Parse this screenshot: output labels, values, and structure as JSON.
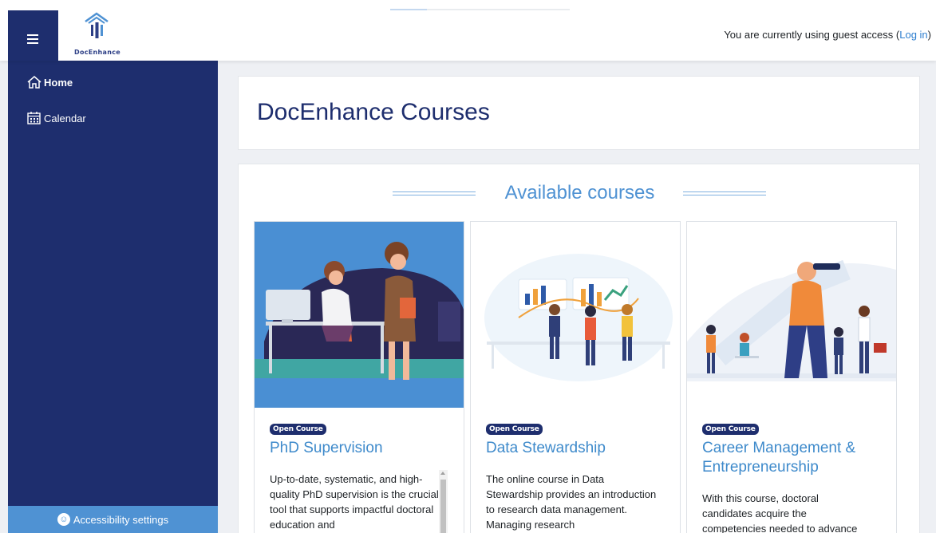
{
  "header": {
    "brand": "DocEnhance",
    "guest_text": "You are currently using guest access (",
    "login_link": "Log in",
    "guest_close": ")"
  },
  "sidebar": {
    "items": [
      {
        "label": "Home",
        "icon": "home-icon"
      },
      {
        "label": "Calendar",
        "icon": "calendar-icon"
      }
    ],
    "accessibility": "Accessibility settings"
  },
  "page": {
    "title": "DocEnhance Courses",
    "section_title": "Available courses"
  },
  "courses": [
    {
      "badge": "Open Course",
      "title": "PhD Supervision",
      "description": "Up-to-date, systematic, and high-quality PhD supervision is the crucial tool that supports impactful doctoral education and"
    },
    {
      "badge": "Open Course",
      "title": "Data Stewardship",
      "description": "The online course in Data Stewardship provides an introduction to research data management. Managing research"
    },
    {
      "badge": "Open Course",
      "title": "Career Management & Entrepreneurship",
      "description": "With this course, doctoral candidates acquire the competencies needed to advance"
    }
  ],
  "colors": {
    "navy": "#1e2e6e",
    "accent": "#4f92d3",
    "link": "#2f7fcf"
  }
}
